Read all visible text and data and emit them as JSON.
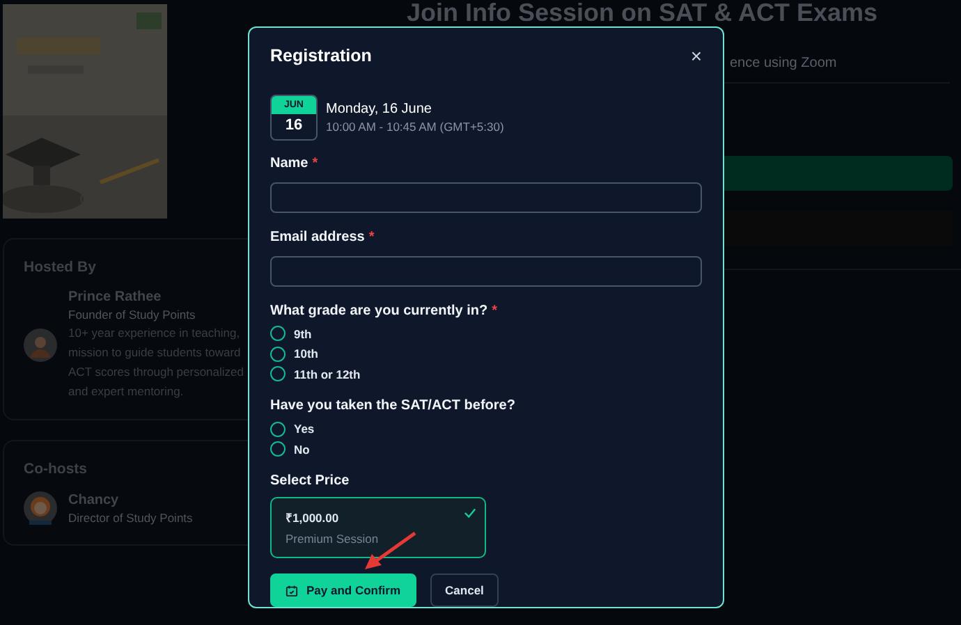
{
  "page": {
    "title": "Join Info Session on SAT & ACT Exams",
    "subtitle": "ence using Zoom",
    "hosted_by": {
      "heading": "Hosted By",
      "name": "Prince Rathee",
      "role": "Founder of Study Points",
      "bio_lines": [
        "10+ year experience in teaching,",
        "mission to guide students toward",
        "ACT scores through personalized",
        "and expert mentoring."
      ]
    },
    "co_hosts": {
      "heading": "Co-hosts",
      "people": [
        {
          "name": "Chancy",
          "role": "Director of Study Points"
        }
      ]
    }
  },
  "dialog": {
    "title": "Registration",
    "close": "×",
    "required_mark": "*",
    "date": {
      "month": "JUN",
      "day": "16",
      "label": "Monday, 16 June",
      "time": "10:00 AM - 10:45 AM (GMT+5:30)"
    },
    "fields": [
      {
        "label": "Name",
        "required": true
      },
      {
        "label": "Email address",
        "required": true
      }
    ],
    "questions": [
      {
        "label": "What grade are you currently in?",
        "required": true,
        "options": [
          {
            "label": "9th",
            "selected": false
          },
          {
            "label": "10th",
            "selected": false
          },
          {
            "label": "11th or 12th",
            "selected": false
          }
        ]
      },
      {
        "label": "Have you taken the SAT/ACT before?",
        "options": [
          {
            "label": "Yes",
            "selected": false
          },
          {
            "label": "No",
            "selected": false
          }
        ]
      }
    ],
    "price": {
      "label": "Select Price",
      "options": [
        {
          "amount": "₹1,000.00",
          "name": "Premium Session",
          "selected": true
        }
      ]
    },
    "buttons": [
      {
        "label": "Pay and Confirm",
        "kind": "primary"
      },
      {
        "label": "Cancel",
        "kind": "secondary"
      }
    ]
  }
}
